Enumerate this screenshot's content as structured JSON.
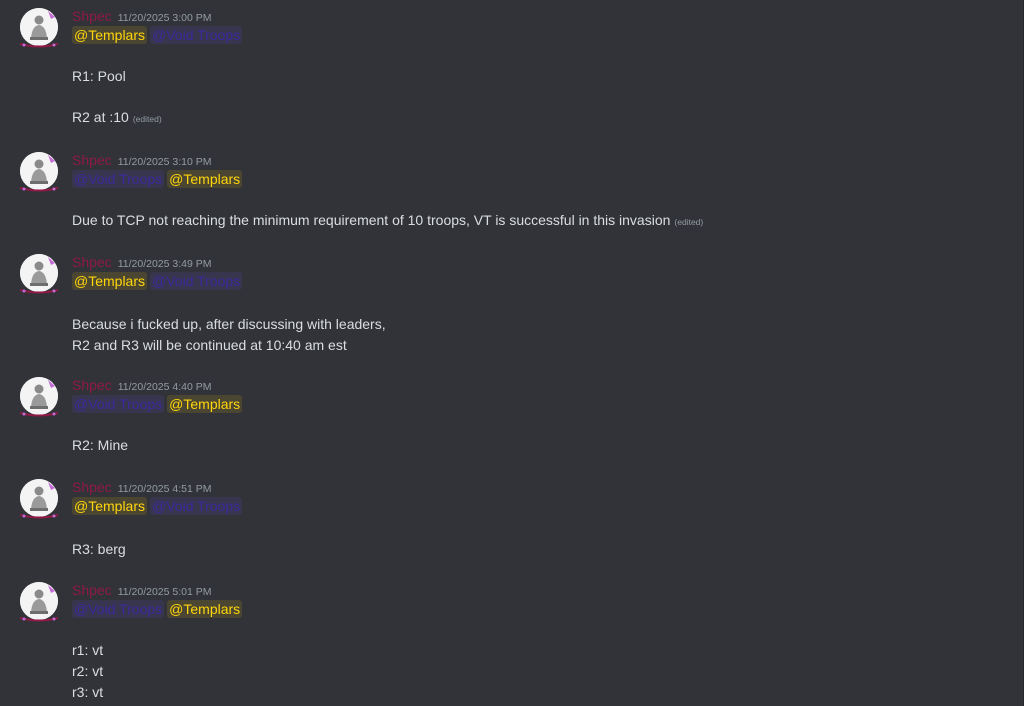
{
  "messages": [
    {
      "author": "Shpec",
      "timestamp": "11/20/2025 3:00 PM",
      "mentions": [
        "@Templars",
        "@Void Troops"
      ],
      "lines": [
        "R1: Pool",
        "R2 at :10"
      ],
      "edited_label": "(edited)"
    },
    {
      "author": "Shpec",
      "timestamp": "11/20/2025 3:10 PM",
      "mentions": [
        "@Void Troops",
        "@Templars"
      ],
      "lines": [
        "Due to TCP not reaching the minimum requirement of 10 troops, VT is successful in this invasion"
      ],
      "edited_label": "(edited)"
    },
    {
      "author": "Shpec",
      "timestamp": "11/20/2025 3:49 PM",
      "mentions": [
        "@Templars",
        "@Void Troops"
      ],
      "lines": [
        "Because i fucked up, after discussing with leaders,",
        "R2 and R3 will be continued at 10:40 am est"
      ]
    },
    {
      "author": "Shpec",
      "timestamp": "11/20/2025 4:40 PM",
      "mentions": [
        "@Void Troops",
        "@Templars"
      ],
      "lines": [
        "R2: Mine"
      ]
    },
    {
      "author": "Shpec",
      "timestamp": "11/20/2025 4:51 PM",
      "mentions": [
        "@Templars",
        "@Void Troops"
      ],
      "lines": [
        "R3: berg"
      ]
    },
    {
      "author": "Shpec",
      "timestamp": "11/20/2025 5:01 PM",
      "mentions": [
        "@Void Troops",
        "@Templars"
      ],
      "lines": [
        "r1: vt",
        "r2: vt",
        "r3: vt"
      ]
    }
  ],
  "colors": {
    "background": "#313338",
    "author": "#8f1a45",
    "templars_mention": "#ffd60a",
    "void_troops_mention": "#3a2a9c",
    "text": "#dbdee1",
    "timestamp": "#949ba4"
  },
  "icons": {
    "avatar": "statue-avatar-icon",
    "avatar_decoration": "avatar-decoration-icon"
  }
}
